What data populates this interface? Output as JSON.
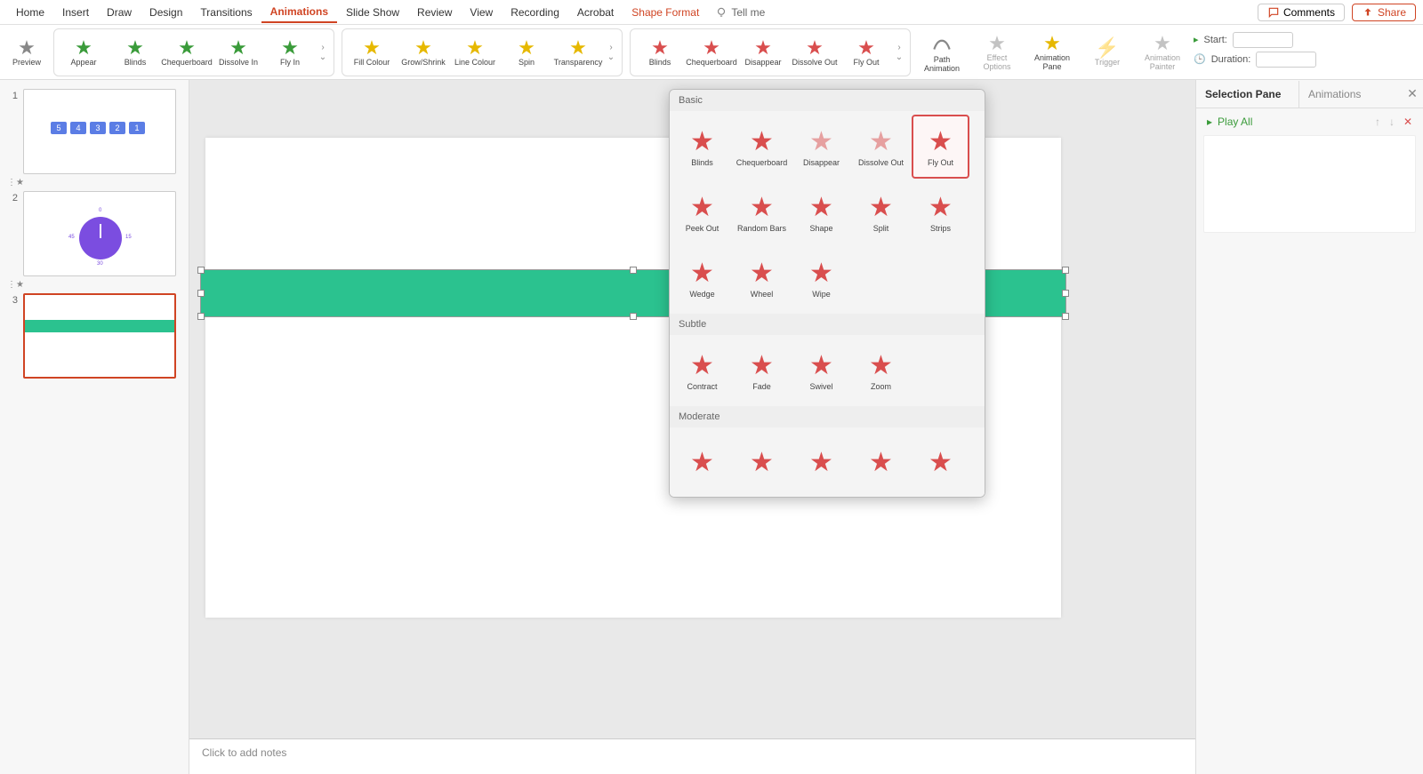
{
  "tabs": {
    "home": "Home",
    "insert": "Insert",
    "draw": "Draw",
    "design": "Design",
    "transitions": "Transitions",
    "animations": "Animations",
    "slideshow": "Slide Show",
    "review": "Review",
    "view": "View",
    "recording": "Recording",
    "acrobat": "Acrobat",
    "shape_format": "Shape Format",
    "tell_me": "Tell me",
    "comments": "Comments",
    "share": "Share"
  },
  "ribbon": {
    "preview": "Preview",
    "entrance": {
      "appear": "Appear",
      "blinds": "Blinds",
      "chequerboard": "Chequerboard",
      "dissolve_in": "Dissolve In",
      "fly_in": "Fly In"
    },
    "emphasis": {
      "fill_colour": "Fill Colour",
      "grow_shrink": "Grow/Shrink",
      "line_colour": "Line Colour",
      "spin": "Spin",
      "transparency": "Transparency"
    },
    "exit": {
      "blinds": "Blinds",
      "chequerboard": "Chequerboard",
      "disappear": "Disappear",
      "dissolve_out": "Dissolve Out",
      "fly_out": "Fly Out"
    },
    "path_animation": "Path Animation",
    "effect_options": "Effect Options",
    "animation_pane": "Animation Pane",
    "trigger": "Trigger",
    "animation_painter": "Animation Painter",
    "start": "Start:",
    "duration": "Duration:"
  },
  "dropdown": {
    "basic_title": "Basic",
    "subtle_title": "Subtle",
    "moderate_title": "Moderate",
    "basic": {
      "blinds": "Blinds",
      "chequerboard": "Chequerboard",
      "disappear": "Disappear",
      "dissolve_out": "Dissolve Out",
      "fly_out": "Fly Out",
      "peek_out": "Peek Out",
      "random_bars": "Random Bars",
      "shape": "Shape",
      "split": "Split",
      "strips": "Strips",
      "wedge": "Wedge",
      "wheel": "Wheel",
      "wipe": "Wipe"
    },
    "subtle": {
      "contract": "Contract",
      "fade": "Fade",
      "swivel": "Swivel",
      "zoom": "Zoom"
    }
  },
  "slides": {
    "s1_boxes": [
      "5",
      "4",
      "3",
      "2",
      "1"
    ],
    "s2_labels": {
      "top": "0",
      "right": "15",
      "bottom": "30",
      "left": "45"
    },
    "notes_placeholder": "Click to add notes"
  },
  "right_panel": {
    "selection_pane": "Selection Pane",
    "animations": "Animations",
    "play_all": "Play All"
  }
}
